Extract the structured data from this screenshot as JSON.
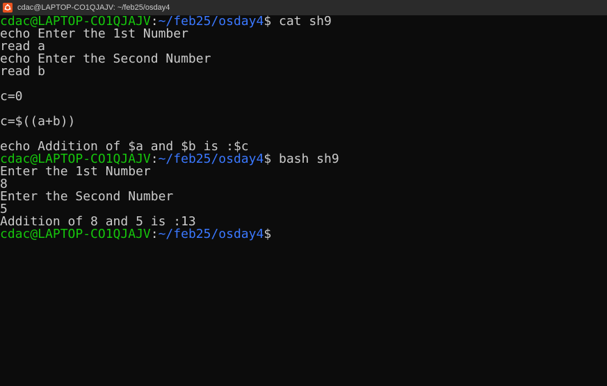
{
  "window": {
    "title": "cdac@LAPTOP-CO1QJAJV: ~/feb25/osday4",
    "icon": "ubuntu-icon",
    "colors": {
      "background": "#0c0c0c",
      "titlebar": "#2b2b2b",
      "prompt_user": "#16c60c",
      "prompt_path": "#3b78ff",
      "text": "#cccccc",
      "icon_bg": "#e95420"
    }
  },
  "terminal": {
    "prompt": {
      "user_host": "cdac@LAPTOP-CO1QJAJV",
      "separator": ":",
      "path": "~/feb25/osday4",
      "symbol": "$"
    },
    "lines": [
      "echo Enter the 1st Number",
      "read a",
      "echo Enter the Second Number",
      "read b",
      "",
      "c=0",
      "",
      "c=$((a+b))",
      "",
      "echo Addition of $a and $b is :$c",
      "Enter the 1st Number",
      "8",
      "Enter the Second Number",
      "5",
      "Addition of 8 and 5 is :13"
    ],
    "commands": [
      " cat sh9",
      " bash sh9"
    ]
  }
}
